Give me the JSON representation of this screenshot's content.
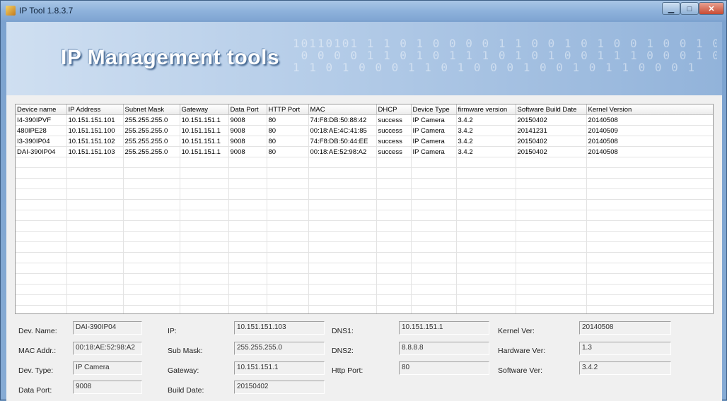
{
  "window": {
    "title": "IP Tool 1.8.3.7",
    "min_glyph": "▁",
    "max_glyph": "□",
    "close_glyph": "✕"
  },
  "banner": {
    "title": "IP Management tools",
    "bits": "10110101 1 1 0 1 0 0 0 0 1 1 0 0 1 0 1 0 0 1 0 0 1 0 1 1\n 0 0 0 0 1 1 0 1 0 1 1 1 0 1 0 1 0 0 1 1 1 0 0 0 1 0 1\n1 1 0 1 0 0 0 1 1 0 1 0 0 0 1 0 0 1 0 1 1 0 0 0 1"
  },
  "table": {
    "columns": [
      "Device name",
      "IP Address",
      "Subnet Mask",
      "Gateway",
      "Data Port",
      "HTTP Port",
      "MAC",
      "DHCP",
      "Device Type",
      "firmware version",
      "Software Build Date",
      "Kernel Version"
    ],
    "rows": [
      [
        "I4-390IPVF",
        "10.151.151.101",
        "255.255.255.0",
        "10.151.151.1",
        "9008",
        "80",
        "74:F8:DB:50:88:42",
        "success",
        "IP Camera",
        "3.4.2",
        "20150402",
        "20140508"
      ],
      [
        "480IPE28",
        "10.151.151.100",
        "255.255.255.0",
        "10.151.151.1",
        "9008",
        "80",
        "00:18:AE:4C:41:85",
        "success",
        "IP Camera",
        "3.4.2",
        "20141231",
        "20140509"
      ],
      [
        "I3-390IP04",
        "10.151.151.102",
        "255.255.255.0",
        "10.151.151.1",
        "9008",
        "80",
        "74:F8:DB:50:44:EE",
        "success",
        "IP Camera",
        "3.4.2",
        "20150402",
        "20140508"
      ],
      [
        "DAI-390IP04",
        "10.151.151.103",
        "255.255.255.0",
        "10.151.151.1",
        "9008",
        "80",
        "00:18:AE:52:98:A2",
        "success",
        "IP Camera",
        "3.4.2",
        "20150402",
        "20140508"
      ]
    ]
  },
  "detail": {
    "dev_name_label": "Dev. Name:",
    "dev_name": "DAI-390IP04",
    "mac_label": "MAC Addr.:",
    "mac": "00:18:AE:52:98:A2",
    "dev_type_label": "Dev. Type:",
    "dev_type": "IP Camera",
    "data_port_label": "Data Port:",
    "data_port": "9008",
    "ip_label": "IP:",
    "ip": "10.151.151.103",
    "sub_mask_label": "Sub Mask:",
    "sub_mask": "255.255.255.0",
    "gateway_label": "Gateway:",
    "gateway": "10.151.151.1",
    "build_date_label": "Build Date:",
    "build_date": "20150402",
    "dns1_label": "DNS1:",
    "dns1": "10.151.151.1",
    "dns2_label": "DNS2:",
    "dns2": "8.8.8.8",
    "http_port_label": "Http Port:",
    "http_port": "80",
    "kernel_label": "Kernel Ver:",
    "kernel": "20140508",
    "hardware_label": "Hardware Ver:",
    "hardware": "1.3",
    "software_label": "Software Ver:",
    "software": "3.4.2"
  }
}
